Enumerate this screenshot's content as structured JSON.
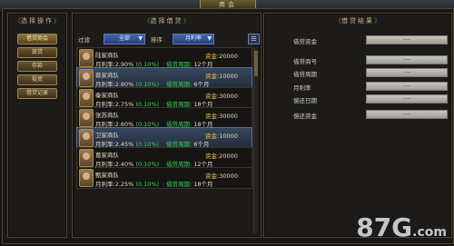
{
  "header": {
    "title": "商会"
  },
  "left_panel": {
    "title": "选择操作",
    "buttons": [
      {
        "label": "借贷商会",
        "active": true
      },
      {
        "label": "放贷"
      },
      {
        "label": "存款"
      },
      {
        "label": "投资"
      },
      {
        "label": "借贷记录"
      }
    ]
  },
  "mid_panel": {
    "title": "选择借贷",
    "filter_label": "过滤",
    "filter_value": "全部",
    "sort_label": "排序",
    "sort_value": "月利率",
    "items": [
      {
        "name": "陆家商队",
        "rate_label": "月利率:",
        "rate": "2.90%",
        "rate_extra": "(0.10%)",
        "fund_label": "资金:",
        "fund": "20000",
        "period_label": "借贷周期:",
        "period": "12个月"
      },
      {
        "name": "蔡家商队",
        "rate_label": "月利率:",
        "rate": "2.80%",
        "rate_extra": "(0.10%)",
        "fund_label": "资金:",
        "fund": "10000",
        "period_label": "借贷周期:",
        "period": "6个月"
      },
      {
        "name": "秦家商队",
        "rate_label": "月利率:",
        "rate": "2.75%",
        "rate_extra": "(0.10%)",
        "fund_label": "资金:",
        "fund": "30000",
        "period_label": "借贷周期:",
        "period": "18个月"
      },
      {
        "name": "张苏商队",
        "rate_label": "月利率:",
        "rate": "2.60%",
        "rate_extra": "(0.10%)",
        "fund_label": "资金:",
        "fund": "30000",
        "period_label": "借贷周期:",
        "period": "18个月"
      },
      {
        "name": "卫家商队",
        "rate_label": "月利率:",
        "rate": "2.45%",
        "rate_extra": "(0.10%)",
        "fund_label": "资金:",
        "fund": "10000",
        "period_label": "借贷周期:",
        "period": "6个月"
      },
      {
        "name": "葛家商队",
        "rate_label": "月利率:",
        "rate": "2.40%",
        "rate_extra": "(0.10%)",
        "fund_label": "资金:",
        "fund": "20000",
        "period_label": "借贷周期:",
        "period": "12个月"
      },
      {
        "name": "甄家商队",
        "rate_label": "月利率:",
        "rate": "2.25%",
        "rate_extra": "(0.10%)",
        "fund_label": "资金:",
        "fund": "30000",
        "period_label": "借贷周期:",
        "period": "18个月"
      }
    ]
  },
  "right_panel": {
    "title": "借贷结果",
    "fields": [
      {
        "label": "借贷资金",
        "value": "----"
      },
      {
        "label": "借贷商号",
        "value": "----"
      },
      {
        "label": "借贷周期",
        "value": "----"
      },
      {
        "label": "月利率",
        "value": "----"
      },
      {
        "label": "偿还日期",
        "value": "----"
      },
      {
        "label": "偿还资金",
        "value": "----"
      }
    ]
  },
  "watermark": {
    "text": "87G",
    "suffix": ".com"
  },
  "colors": {
    "accent_gold": "#e8c14a",
    "green": "#34d04f",
    "select_blue": "#3a5ea1"
  }
}
